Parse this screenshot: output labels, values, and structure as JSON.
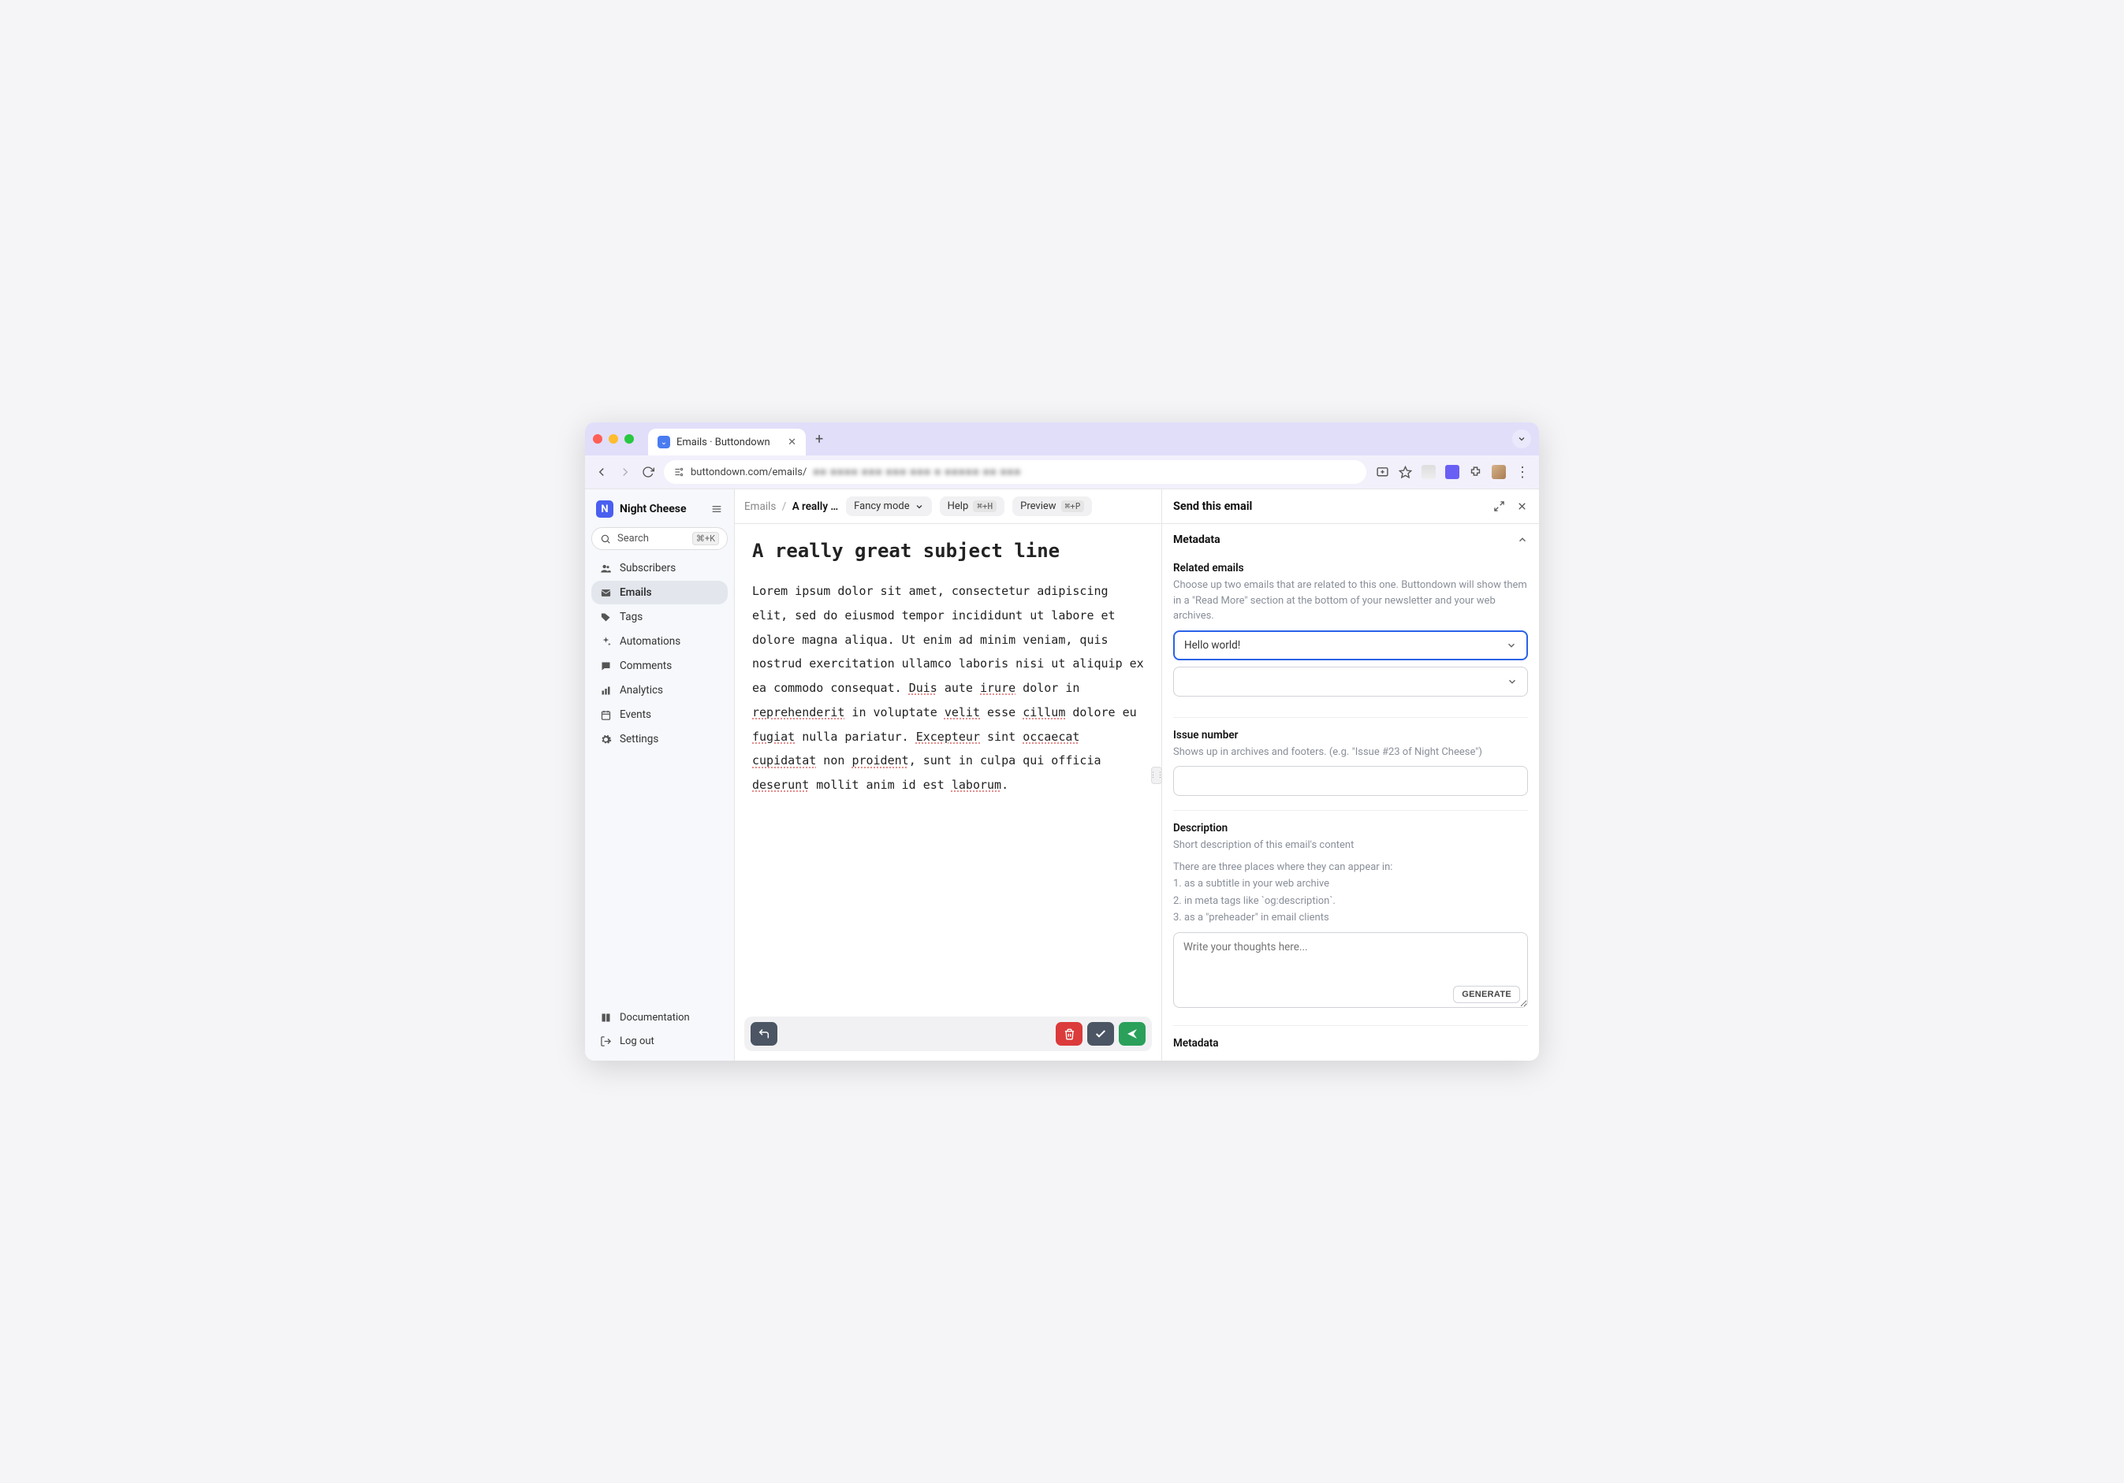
{
  "browser": {
    "tab_title": "Emails · Buttondown",
    "url_prefix": "buttondown.com/emails/",
    "url_blur": "■■  ■■■■ ■■■ ■■■ ■■■ ■ ■■■■■ ■■  ■■■"
  },
  "sidebar": {
    "brand_logo": "N",
    "brand_name": "Night Cheese",
    "search_placeholder": "Search",
    "search_kbd": "⌘+K",
    "items": [
      {
        "icon": "users",
        "label": "Subscribers"
      },
      {
        "icon": "mail",
        "label": "Emails"
      },
      {
        "icon": "tag",
        "label": "Tags"
      },
      {
        "icon": "sparkle",
        "label": "Automations"
      },
      {
        "icon": "comment",
        "label": "Comments"
      },
      {
        "icon": "chart",
        "label": "Analytics"
      },
      {
        "icon": "calendar",
        "label": "Events"
      },
      {
        "icon": "gear",
        "label": "Settings"
      }
    ],
    "bottom": [
      {
        "icon": "book",
        "label": "Documentation"
      },
      {
        "icon": "logout",
        "label": "Log out"
      }
    ]
  },
  "topbar": {
    "crumb_root": "Emails",
    "crumb_current": "A really …",
    "mode_label": "Fancy mode",
    "help_label": "Help",
    "help_kbd": "⌘+H",
    "preview_label": "Preview",
    "preview_kbd": "⌘+P"
  },
  "editor": {
    "subject": "A really great subject line",
    "body": "Lorem ipsum dolor sit amet, consectetur adipiscing elit, sed do eiusmod tempor incididunt ut labore et dolore magna aliqua. Ut enim ad minim veniam, quis nostrud exercitation ullamco laboris nisi ut aliquip ex ea commodo consequat. Duis aute irure dolor in reprehenderit in voluptate velit esse cillum dolore eu fugiat nulla pariatur. Excepteur sint occaecat cupidatat non proident, sunt in culpa qui officia deserunt mollit anim id est laborum."
  },
  "right": {
    "title": "Send this email",
    "metadata_heading": "Metadata",
    "related": {
      "label": "Related emails",
      "help": "Choose up two emails that are related to this one. Buttondown will show them in a \"Read More\" section at the bottom of your newsletter and your web archives.",
      "selected": "Hello world!"
    },
    "issue": {
      "label": "Issue number",
      "help": "Shows up in archives and footers. (e.g. \"Issue #23 of Night Cheese\")"
    },
    "description": {
      "label": "Description",
      "help1": "Short description of this email's content",
      "help2": "There are three places where they can appear in:",
      "help3": "1. as a subtitle in your web archive",
      "help4": "2. in meta tags like `og:description`.",
      "help5": "3. as a \"preheader\" in email clients",
      "placeholder": "Write your thoughts here...",
      "generate": "GENERATE"
    },
    "metadata2_heading": "Metadata"
  }
}
